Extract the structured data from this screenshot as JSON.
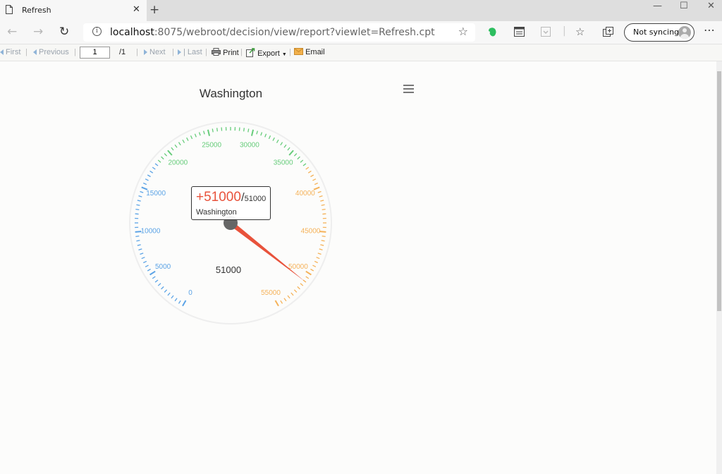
{
  "browser": {
    "tab_title": "Refresh",
    "url_host": "localhost",
    "url_rest": ":8075/webroot/decision/view/report?viewlet=Refresh.cpt",
    "sync_label": "Not syncing"
  },
  "toolbar": {
    "first": "First",
    "previous": "Previous",
    "page_value": "1",
    "page_total": "/1",
    "next": "Next",
    "last": "Last",
    "print": "Print",
    "export": "Export",
    "email": "Email"
  },
  "chart_data": {
    "type": "gauge",
    "title": "Washington",
    "min": 0,
    "max": 55000,
    "value": 51000,
    "value_label": "51000",
    "tick_labels": [
      "0",
      "5000",
      "10000",
      "15000",
      "20000",
      "25000",
      "30000",
      "35000",
      "40000",
      "45000",
      "50000",
      "55000"
    ],
    "color_bands": [
      {
        "from": 0,
        "to": 18000,
        "color": "#5ba3e6"
      },
      {
        "from": 18000,
        "to": 37000,
        "color": "#66cc7a"
      },
      {
        "from": 37000,
        "to": 55000,
        "color": "#f5b259"
      }
    ],
    "needle_color": "#e8523b",
    "tooltip": {
      "value": "+51000",
      "total": "51000",
      "name": "Washington"
    }
  }
}
